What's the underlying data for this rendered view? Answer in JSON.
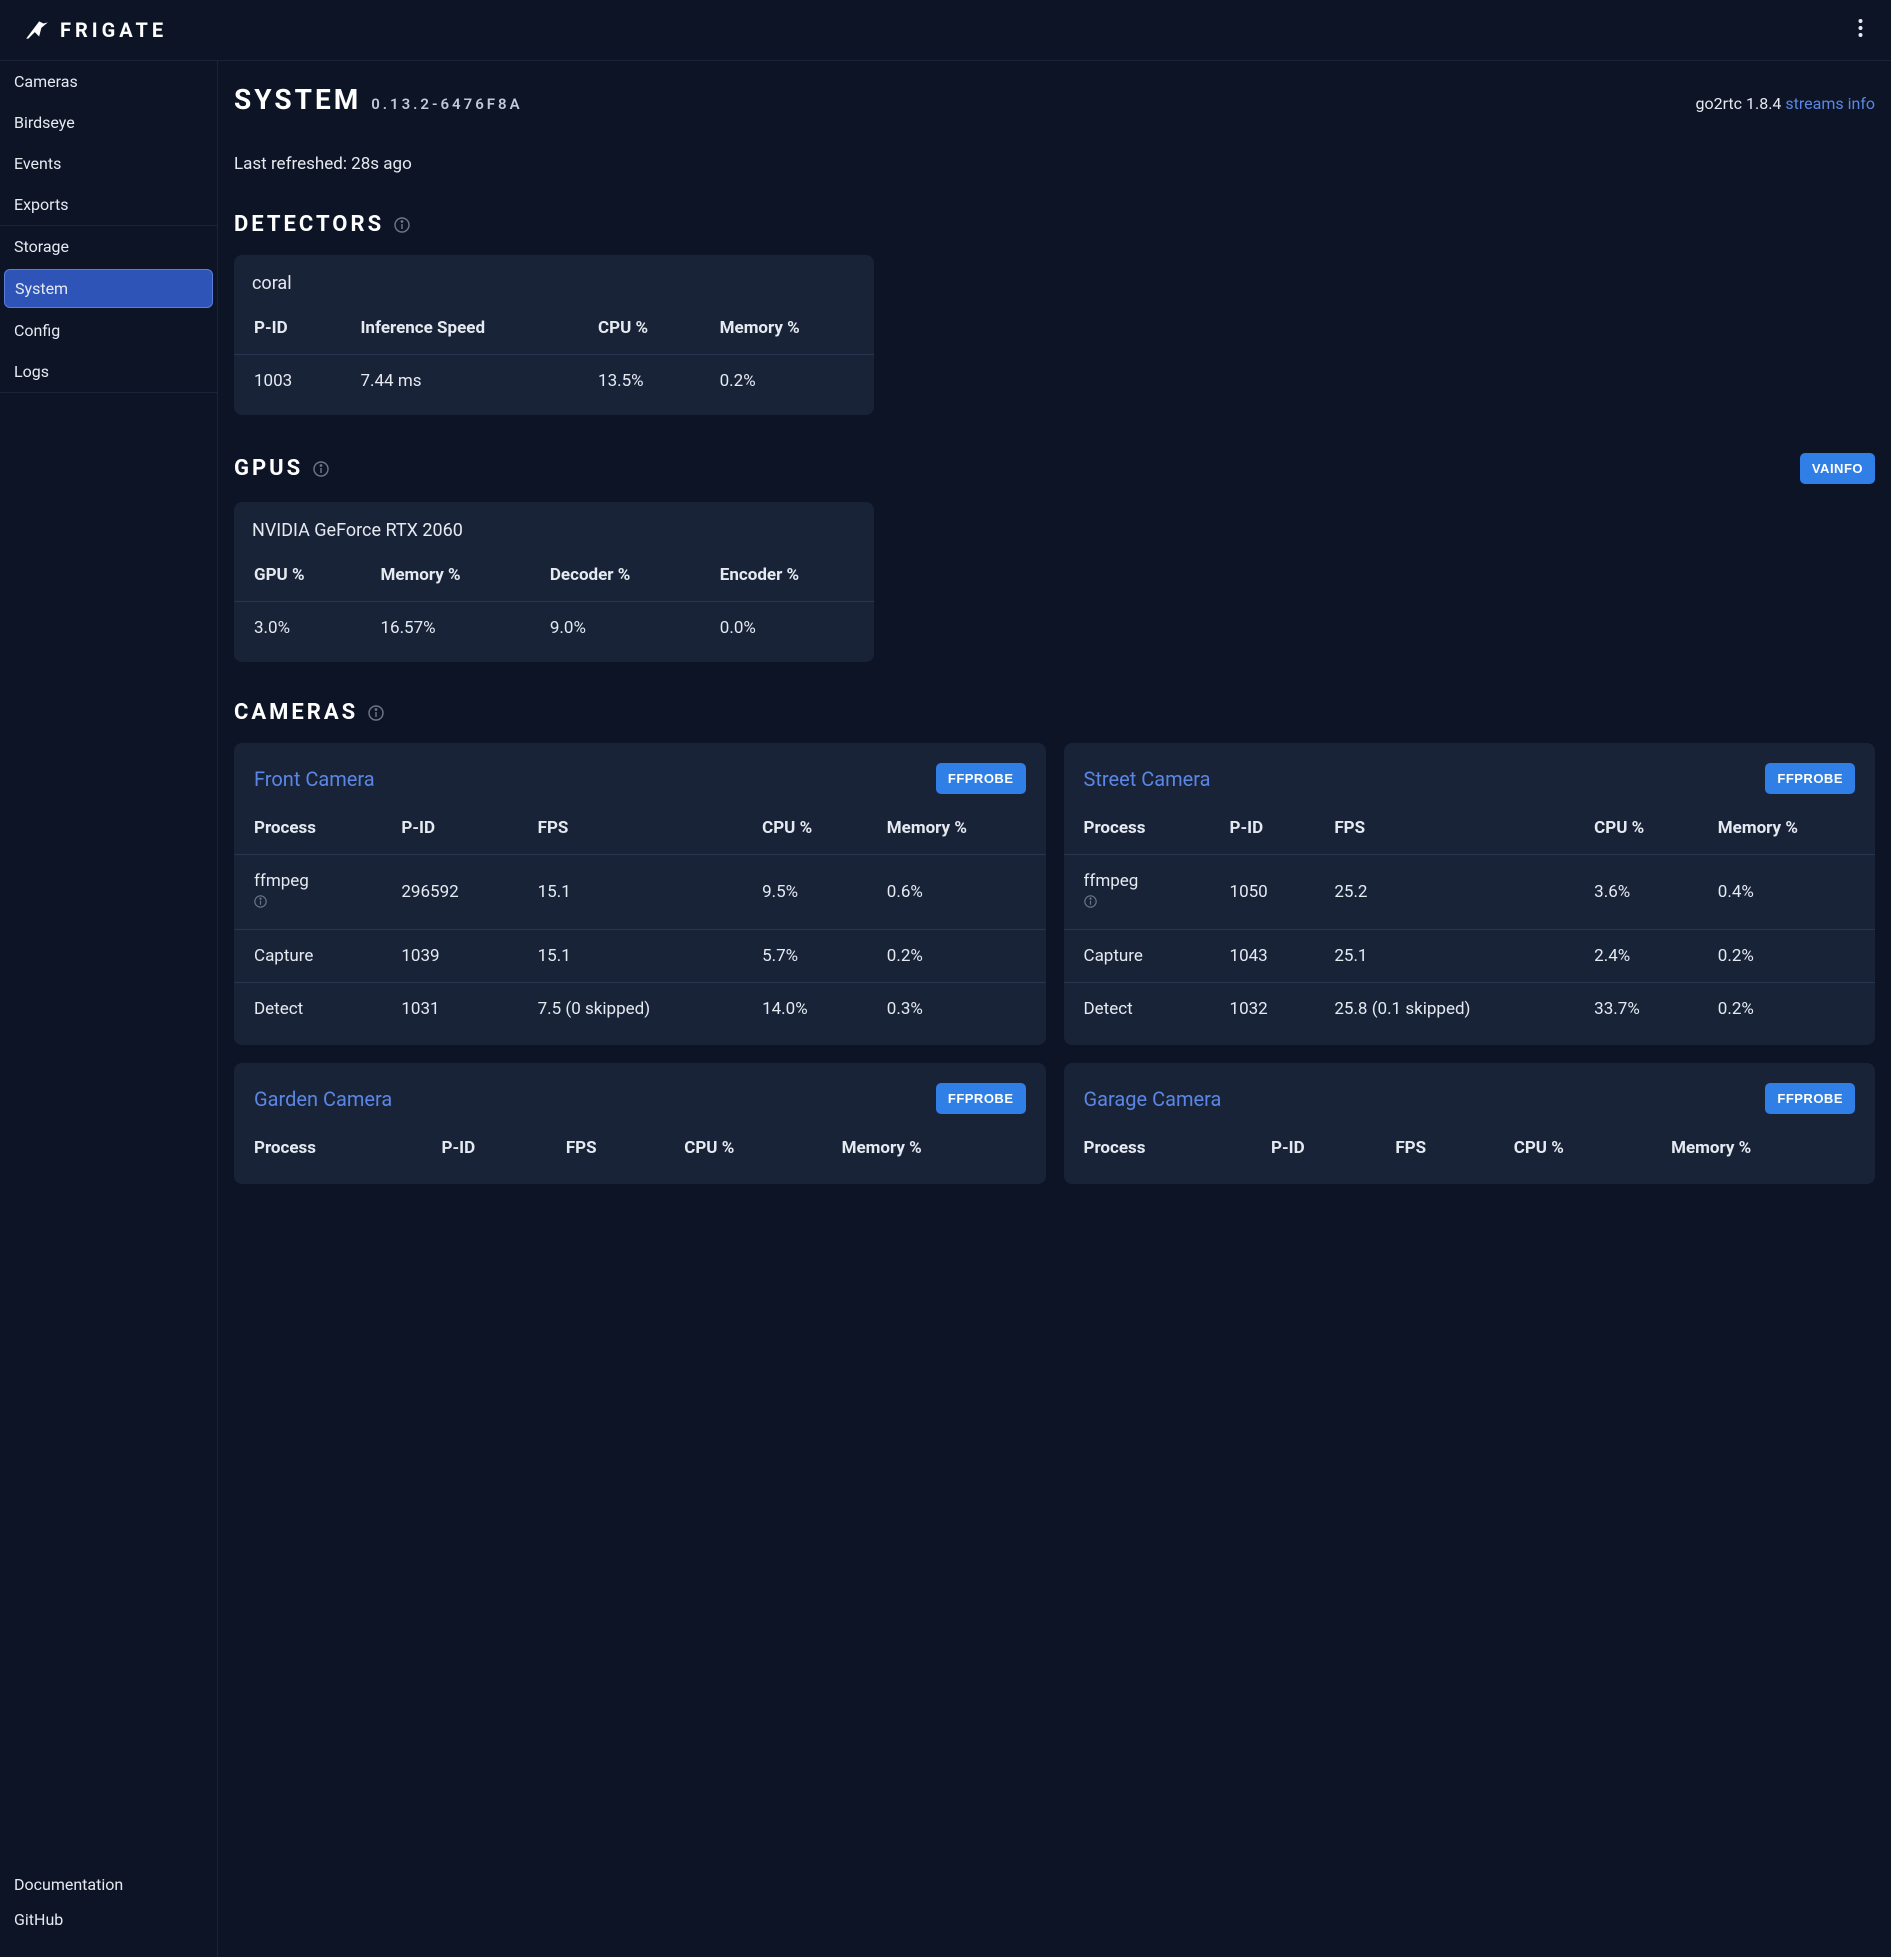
{
  "app": {
    "name": "FRIGATE"
  },
  "sidebar": {
    "group1": [
      {
        "label": "Cameras"
      },
      {
        "label": "Birdseye"
      },
      {
        "label": "Events"
      },
      {
        "label": "Exports"
      }
    ],
    "group2": [
      {
        "label": "Storage"
      },
      {
        "label": "System",
        "active": true
      },
      {
        "label": "Config"
      },
      {
        "label": "Logs"
      }
    ],
    "footer": [
      {
        "label": "Documentation"
      },
      {
        "label": "GitHub"
      }
    ]
  },
  "page": {
    "title": "SYSTEM",
    "version": "0.13.2-6476F8A",
    "go2rtc_label": "go2rtc 1.8.4",
    "streams_link": "streams info",
    "refresh": "Last refreshed: 28s ago"
  },
  "detectors": {
    "title": "DETECTORS",
    "items": [
      {
        "name": "coral",
        "headers": [
          "P-ID",
          "Inference Speed",
          "CPU %",
          "Memory %"
        ],
        "row": [
          "1003",
          "7.44 ms",
          "13.5%",
          "0.2%"
        ]
      }
    ]
  },
  "gpus": {
    "title": "GPUS",
    "vainfo_btn": "VAINFO",
    "items": [
      {
        "name": "NVIDIA GeForce RTX 2060",
        "headers": [
          "GPU %",
          "Memory %",
          "Decoder %",
          "Encoder %"
        ],
        "row": [
          "3.0%",
          "16.57%",
          "9.0%",
          "0.0%"
        ]
      }
    ]
  },
  "cameras": {
    "title": "CAMERAS",
    "ffprobe_btn": "FFPROBE",
    "headers": [
      "Process",
      "P-ID",
      "FPS",
      "CPU %",
      "Memory %"
    ],
    "items": [
      {
        "name": "Front Camera",
        "rows": [
          {
            "process": "ffmpeg",
            "info": true,
            "pid": "296592",
            "fps": "15.1",
            "cpu": "9.5%",
            "mem": "0.6%"
          },
          {
            "process": "Capture",
            "pid": "1039",
            "fps": "15.1",
            "cpu": "5.7%",
            "mem": "0.2%"
          },
          {
            "process": "Detect",
            "pid": "1031",
            "fps": "7.5 (0 skipped)",
            "cpu": "14.0%",
            "mem": "0.3%"
          }
        ]
      },
      {
        "name": "Street Camera",
        "rows": [
          {
            "process": "ffmpeg",
            "info": true,
            "pid": "1050",
            "fps": "25.2",
            "cpu": "3.6%",
            "mem": "0.4%"
          },
          {
            "process": "Capture",
            "pid": "1043",
            "fps": "25.1",
            "cpu": "2.4%",
            "mem": "0.2%"
          },
          {
            "process": "Detect",
            "pid": "1032",
            "fps": "25.8 (0.1 skipped)",
            "cpu": "33.7%",
            "mem": "0.2%"
          }
        ]
      },
      {
        "name": "Garden Camera",
        "rows": []
      },
      {
        "name": "Garage Camera",
        "rows": []
      }
    ]
  }
}
